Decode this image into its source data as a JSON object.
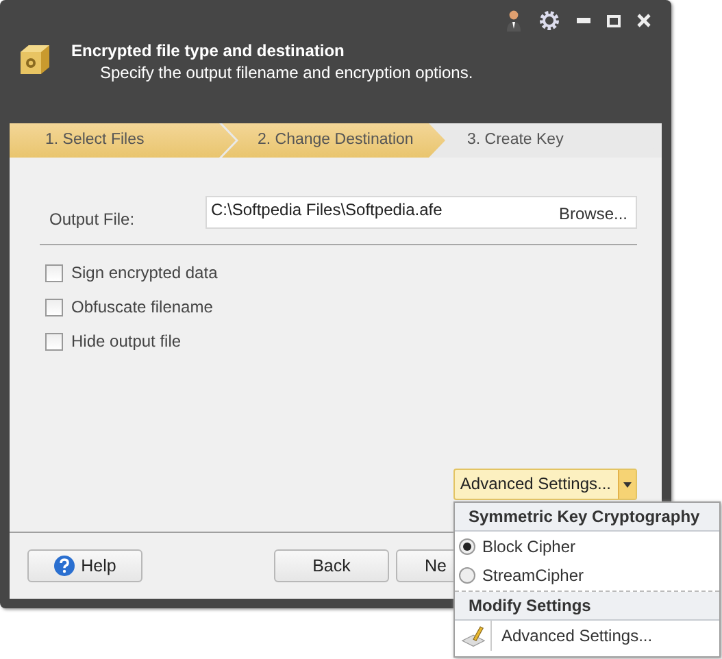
{
  "window": {
    "title": "Encrypted file type and destination",
    "subtitle": "Specify the output filename and encryption options."
  },
  "steps": [
    {
      "label": "1. Select Files",
      "active": true
    },
    {
      "label": "2. Change Destination",
      "active": true
    },
    {
      "label": "3. Create Key",
      "active": false
    }
  ],
  "output_file": {
    "label": "Output File:",
    "value": "C:\\Softpedia Files\\Softpedia.afe",
    "browse": "Browse..."
  },
  "options": [
    {
      "label": "Sign encrypted data",
      "checked": false
    },
    {
      "label": "Obfuscate filename",
      "checked": false
    },
    {
      "label": "Hide output file",
      "checked": false
    }
  ],
  "advanced_button": {
    "label": "Advanced Settings..."
  },
  "buttons": [
    {
      "kind": "help",
      "label": "Help"
    },
    {
      "kind": "back",
      "label": "Back"
    },
    {
      "kind": "next",
      "label": "Ne"
    }
  ],
  "menu": {
    "sections": [
      {
        "title": "Symmetric Key Cryptography",
        "items": [
          {
            "kind": "radio",
            "label": "Block Cipher",
            "selected": true
          },
          {
            "kind": "radio",
            "label": "StreamCipher",
            "selected": false
          }
        ]
      },
      {
        "title": "Modify Settings",
        "items": [
          {
            "kind": "command",
            "label": "Advanced Settings..."
          }
        ]
      }
    ]
  }
}
